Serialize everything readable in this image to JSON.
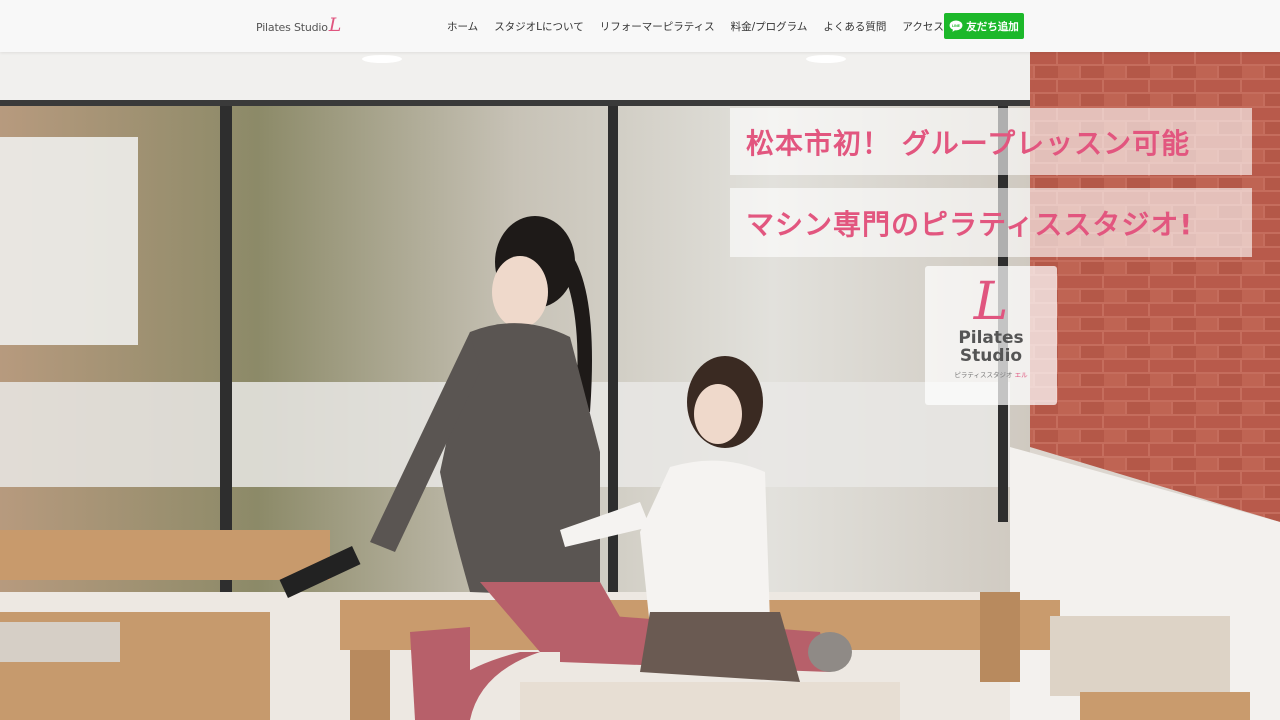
{
  "header": {
    "logo": {
      "text": "Pilates Studio",
      "mark": "L"
    },
    "nav": [
      {
        "label": "ホーム"
      },
      {
        "label": "スタジオLについて"
      },
      {
        "label": "リフォーマーピラティス"
      },
      {
        "label": "料金/プログラム"
      },
      {
        "label": "よくある質問"
      },
      {
        "label": "アクセス"
      }
    ],
    "instagram_icon": "instagram-icon",
    "line_button": {
      "label": "友だち追加",
      "icon": "line-chat-icon",
      "color": "#1cb82a"
    }
  },
  "hero": {
    "headline_1": "松本市初！ グループレッスン可能",
    "headline_2": "マシン専門のピラティススタジオ!",
    "badge": {
      "mark": "L",
      "line1": "Pilates",
      "line2": "Studio",
      "sub_prefix": "ピラティススタジオ",
      "sub_suffix": "エル"
    },
    "accent_color": "#e2567f"
  }
}
